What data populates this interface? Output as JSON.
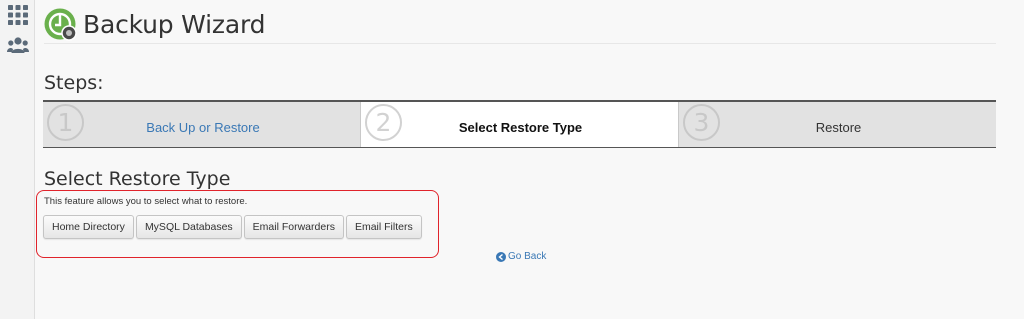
{
  "sidebar": {
    "icons": [
      "grid-icon",
      "users-icon"
    ]
  },
  "header": {
    "title": "Backup Wizard",
    "logo_icon": "backup-wizard-logo-icon"
  },
  "steps": {
    "heading": "Steps:",
    "items": [
      {
        "number": "1",
        "label": "Back Up or Restore",
        "state": "link"
      },
      {
        "number": "2",
        "label": "Select Restore Type",
        "state": "active"
      },
      {
        "number": "3",
        "label": "Restore",
        "state": "inactive"
      }
    ]
  },
  "main": {
    "title": "Select Restore Type",
    "description": "This feature allows you to select what to restore.",
    "buttons": [
      "Home Directory",
      "MySQL Databases",
      "Email Forwarders",
      "Email Filters"
    ],
    "go_back": "Go Back"
  },
  "colors": {
    "link": "#3a78b5",
    "highlight": "#e0232b",
    "logo_green": "#6ab04c"
  }
}
